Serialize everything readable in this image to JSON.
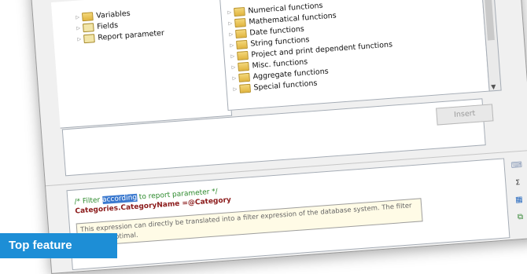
{
  "left_tree": [
    {
      "label": "Variables",
      "icon": "folder-icon"
    },
    {
      "label": "Fields",
      "icon": "table-icon"
    },
    {
      "label": "Report parameter",
      "icon": "report-icon"
    }
  ],
  "function_tree": [
    {
      "label": "Numerical functions"
    },
    {
      "label": "Mathematical functions"
    },
    {
      "label": "Date functions"
    },
    {
      "label": "String functions"
    },
    {
      "label": "Project and print dependent functions"
    },
    {
      "label": "Misc. functions"
    },
    {
      "label": "Aggregate functions"
    },
    {
      "label": "Special functions"
    }
  ],
  "insert_label": "Insert",
  "editor": {
    "comment_before": "/* Filter ",
    "comment_highlight": "according",
    "comment_after": " to report parameter */",
    "expression": "Categories.CategoryName =@Category",
    "tooltip": "This expression can directly be translated into a filter expression of the database system. The filter speed is optimal."
  },
  "toolbar": {
    "sum_label": "Σₒ",
    "icons": [
      "insert-field-icon",
      "sum-icon",
      "formula-icon",
      "table-icon",
      "copy-icon",
      "undo-icon"
    ]
  },
  "banner": "Top feature",
  "colors": {
    "banner": "#1d8ed6",
    "highlight": "#3b79cf",
    "comment": "#2e8b2e",
    "expression": "#8b1a1a"
  }
}
